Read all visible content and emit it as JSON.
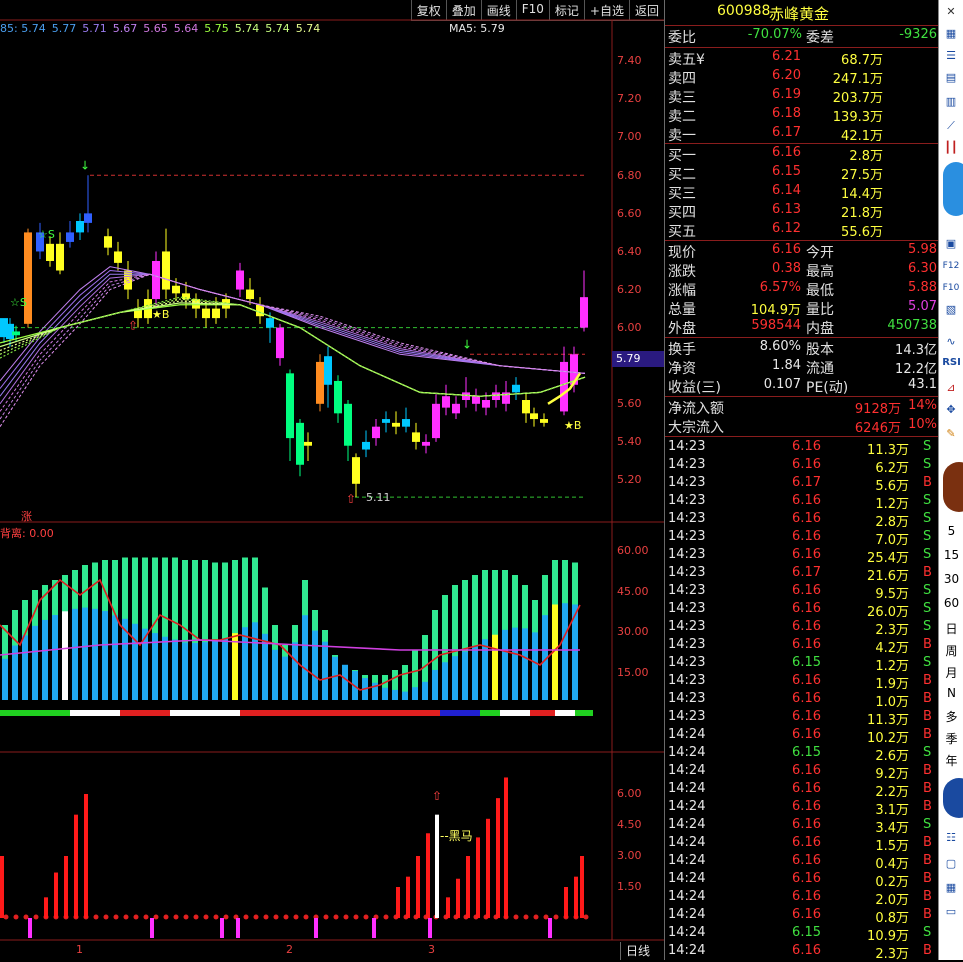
{
  "toolbar": [
    "复权",
    "叠加",
    "画线",
    "F10",
    "标记",
    "+自选",
    "返回"
  ],
  "ma_legend": [
    {
      "text": "85: 5.74",
      "color": "#4a9ff0"
    },
    {
      "text": "5.77",
      "color": "#4a9ff0"
    },
    {
      "text": "5.71",
      "color": "#9a7cf0"
    },
    {
      "text": "5.67",
      "color": "#c080f0"
    },
    {
      "text": "5.65",
      "color": "#d078e0"
    },
    {
      "text": "5.64",
      "color": "#d078e0"
    },
    {
      "text": "5.75",
      "color": "#9cff40"
    },
    {
      "text": "5.74",
      "color": "#c8ff80"
    },
    {
      "text": "5.74",
      "color": "#c8ff80"
    },
    {
      "text": "5.74",
      "color": "#e8ff90"
    }
  ],
  "ma5": "MA5: 5.79",
  "price_axis": [
    "7.40",
    "7.20",
    "7.00",
    "6.80",
    "6.60",
    "6.40",
    "6.20",
    "6.00",
    "5.79",
    "5.60",
    "5.40",
    "5.20"
  ],
  "price_label": "5.79",
  "annotations": {
    "low": "5.11",
    "rise_mark": "涨",
    "star_b": "★B",
    "star_s": "☆S",
    "black_horse": "黑马"
  },
  "macd": {
    "title": "背离: 0.00",
    "axis": [
      "60.00",
      "45.00",
      "30.00",
      "15.00"
    ]
  },
  "vol_axis": [
    "6.00",
    "4.50",
    "3.00",
    "1.50"
  ],
  "x_labels": [
    "1",
    "2",
    "3"
  ],
  "period_label": "日线",
  "stock": {
    "code": "600988",
    "name": "赤峰黄金"
  },
  "committee": {
    "ratio_label": "委比",
    "ratio": "-70.07%",
    "diff_label": "委差",
    "diff": "-9326"
  },
  "asks": [
    {
      "label": "卖五",
      "flag": "¥",
      "price": "6.21",
      "vol": "68.7万"
    },
    {
      "label": "卖四",
      "price": "6.20",
      "vol": "247.1万"
    },
    {
      "label": "卖三",
      "price": "6.19",
      "vol": "203.7万"
    },
    {
      "label": "卖二",
      "price": "6.18",
      "vol": "139.3万"
    },
    {
      "label": "卖一",
      "price": "6.17",
      "vol": "42.1万"
    }
  ],
  "bids": [
    {
      "label": "买一",
      "price": "6.16",
      "vol": "2.8万"
    },
    {
      "label": "买二",
      "price": "6.15",
      "vol": "27.5万"
    },
    {
      "label": "买三",
      "price": "6.14",
      "vol": "14.4万"
    },
    {
      "label": "买四",
      "price": "6.13",
      "vol": "21.8万"
    },
    {
      "label": "买五",
      "price": "6.12",
      "vol": "55.6万"
    }
  ],
  "quote": [
    {
      "l1": "现价",
      "v1": "6.16",
      "c1": "#ff3030",
      "l2": "今开",
      "v2": "5.98",
      "c2": "#ff3030"
    },
    {
      "l1": "涨跌",
      "v1": "0.38",
      "c1": "#ff3030",
      "l2": "最高",
      "v2": "6.30",
      "c2": "#ff3030"
    },
    {
      "l1": "涨幅",
      "v1": "6.57%",
      "c1": "#ff3030",
      "l2": "最低",
      "v2": "5.88",
      "c2": "#ff3030"
    },
    {
      "l1": "总量",
      "v1": "104.9万",
      "c1": "#ffff40",
      "l2": "量比",
      "v2": "5.07",
      "c2": "#e040e0"
    },
    {
      "l1": "外盘",
      "v1": "598544",
      "c1": "#ff3030",
      "l2": "内盘",
      "v2": "450738",
      "c2": "#40e040"
    }
  ],
  "stats": [
    {
      "l1": "换手",
      "v1": "8.60%",
      "l2": "股本",
      "v2": "14.3亿"
    },
    {
      "l1": "净资",
      "v1": "1.84",
      "l2": "流通",
      "v2": "12.2亿"
    },
    {
      "l1": "收益(三)",
      "v1": "0.107",
      "l2": "PE(动)",
      "v2": "43.1"
    }
  ],
  "flows": [
    {
      "label": "净流入额",
      "value": "9128万",
      "pct": "14%"
    },
    {
      "label": "大宗流入",
      "value": "6246万",
      "pct": "10%"
    }
  ],
  "ticks": [
    {
      "t": "14:23",
      "p": "6.16",
      "v": "11.3万",
      "s": "S"
    },
    {
      "t": "14:23",
      "p": "6.16",
      "v": "6.2万",
      "s": "S"
    },
    {
      "t": "14:23",
      "p": "6.17",
      "v": "5.6万",
      "s": "B"
    },
    {
      "t": "14:23",
      "p": "6.16",
      "v": "1.2万",
      "s": "S"
    },
    {
      "t": "14:23",
      "p": "6.16",
      "v": "2.8万",
      "s": "S"
    },
    {
      "t": "14:23",
      "p": "6.16",
      "v": "7.0万",
      "s": "S"
    },
    {
      "t": "14:23",
      "p": "6.16",
      "v": "25.4万",
      "s": "S"
    },
    {
      "t": "14:23",
      "p": "6.17",
      "v": "21.6万",
      "s": "B"
    },
    {
      "t": "14:23",
      "p": "6.16",
      "v": "9.5万",
      "s": "S"
    },
    {
      "t": "14:23",
      "p": "6.16",
      "v": "26.0万",
      "s": "S"
    },
    {
      "t": "14:23",
      "p": "6.16",
      "v": "2.3万",
      "s": "S"
    },
    {
      "t": "14:23",
      "p": "6.16",
      "v": "4.2万",
      "s": "B"
    },
    {
      "t": "14:23",
      "p": "6.15",
      "v": "1.2万",
      "s": "S"
    },
    {
      "t": "14:23",
      "p": "6.16",
      "v": "1.9万",
      "s": "B"
    },
    {
      "t": "14:23",
      "p": "6.16",
      "v": "1.0万",
      "s": "B"
    },
    {
      "t": "14:23",
      "p": "6.16",
      "v": "11.3万",
      "s": "B"
    },
    {
      "t": "14:24",
      "p": "6.16",
      "v": "10.2万",
      "s": "B"
    },
    {
      "t": "14:24",
      "p": "6.15",
      "v": "2.6万",
      "s": "S"
    },
    {
      "t": "14:24",
      "p": "6.16",
      "v": "9.2万",
      "s": "B"
    },
    {
      "t": "14:24",
      "p": "6.16",
      "v": "2.2万",
      "s": "B"
    },
    {
      "t": "14:24",
      "p": "6.16",
      "v": "3.1万",
      "s": "B"
    },
    {
      "t": "14:24",
      "p": "6.16",
      "v": "3.4万",
      "s": "S"
    },
    {
      "t": "14:24",
      "p": "6.16",
      "v": "1.5万",
      "s": "B"
    },
    {
      "t": "14:24",
      "p": "6.16",
      "v": "0.4万",
      "s": "B"
    },
    {
      "t": "14:24",
      "p": "6.16",
      "v": "0.2万",
      "s": "B"
    },
    {
      "t": "14:24",
      "p": "6.16",
      "v": "2.0万",
      "s": "B"
    },
    {
      "t": "14:24",
      "p": "6.16",
      "v": "0.8万",
      "s": "B"
    },
    {
      "t": "14:24",
      "p": "6.15",
      "v": "10.9万",
      "s": "S"
    },
    {
      "t": "14:24",
      "p": "6.16",
      "v": "2.3万",
      "s": "B"
    }
  ],
  "side": {
    "periods": [
      "5",
      "15",
      "30",
      "60"
    ],
    "cycles": [
      "日",
      "周",
      "月",
      "N",
      "多",
      "季",
      "年"
    ],
    "rsi": "RSI"
  }
}
